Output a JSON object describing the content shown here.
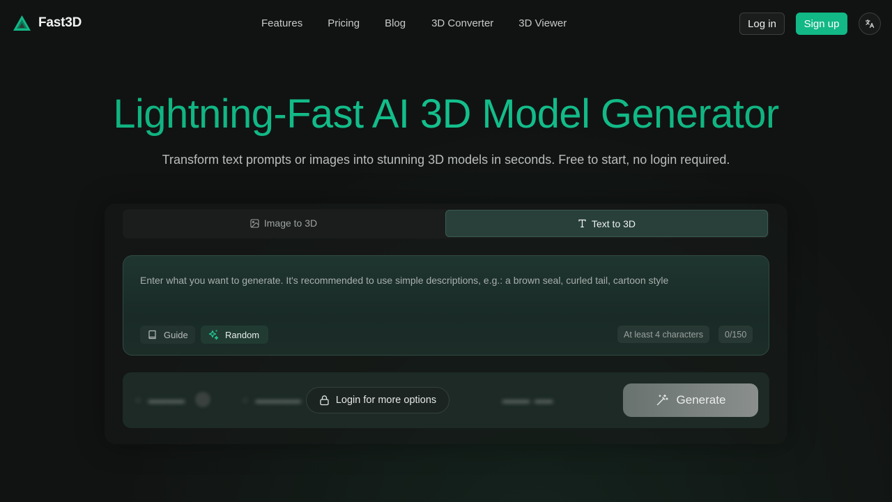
{
  "brand": {
    "name": "Fast3D",
    "logo_icon": "triangle-logo-icon"
  },
  "nav": {
    "links": [
      "Features",
      "Pricing",
      "Blog",
      "3D Converter",
      "3D Viewer"
    ],
    "login_label": "Log in",
    "signup_label": "Sign up",
    "language_icon": "translate-icon"
  },
  "colors": {
    "accent": "#12b886",
    "title": "#10b981",
    "background": "#131514"
  },
  "hero": {
    "title": "Lightning-Fast AI 3D Model Generator",
    "subtitle": "Transform text prompts or images into stunning 3D models in seconds. Free to start, no login required."
  },
  "tabs": [
    {
      "label": "Image to 3D",
      "icon": "image-icon",
      "active": false
    },
    {
      "label": "Text to 3D",
      "icon": "text-icon",
      "active": true
    }
  ],
  "prompt": {
    "placeholder": "Enter what you want to generate. It's recommended to use simple descriptions, e.g.: a brown seal, curled tail, cartoon style",
    "guide_label": "Guide",
    "random_label": "Random",
    "min_hint": "At least 4 characters",
    "char_count": "0/150"
  },
  "actions": {
    "login_more_label": "Login for more options",
    "generate_label": "Generate"
  }
}
